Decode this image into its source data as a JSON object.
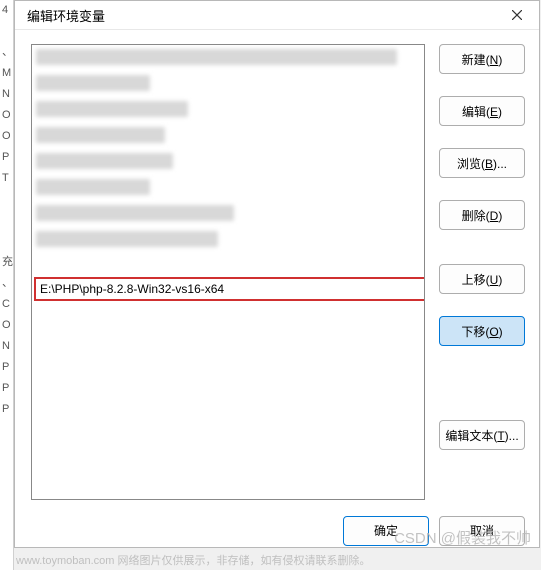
{
  "title": "编辑环境变量",
  "left_edge_labels": [
    "4",
    "",
    "、",
    "M",
    "N",
    "O",
    "O",
    "P",
    "T",
    "",
    "",
    "",
    "充",
    "",
    "C",
    "O",
    "N",
    "P",
    "P",
    "P",
    ""
  ],
  "list": {
    "highlighted_value": "E:\\PHP\\php-8.2.8-Win32-vs16-x64"
  },
  "buttons": {
    "new": "新建(N)",
    "edit": "编辑(E)",
    "browse": "浏览(B)...",
    "delete": "删除(D)",
    "up": "上移(U)",
    "down": "下移(O)",
    "edit_text": "编辑文本(T)..."
  },
  "footer": {
    "ok": "确定",
    "cancel": "取消"
  },
  "watermark_bottom": "www.toymoban.com 网络图片仅供展示，非存储，如有侵权请联系删除。",
  "watermark_right": "CSDN @假装我不帅"
}
